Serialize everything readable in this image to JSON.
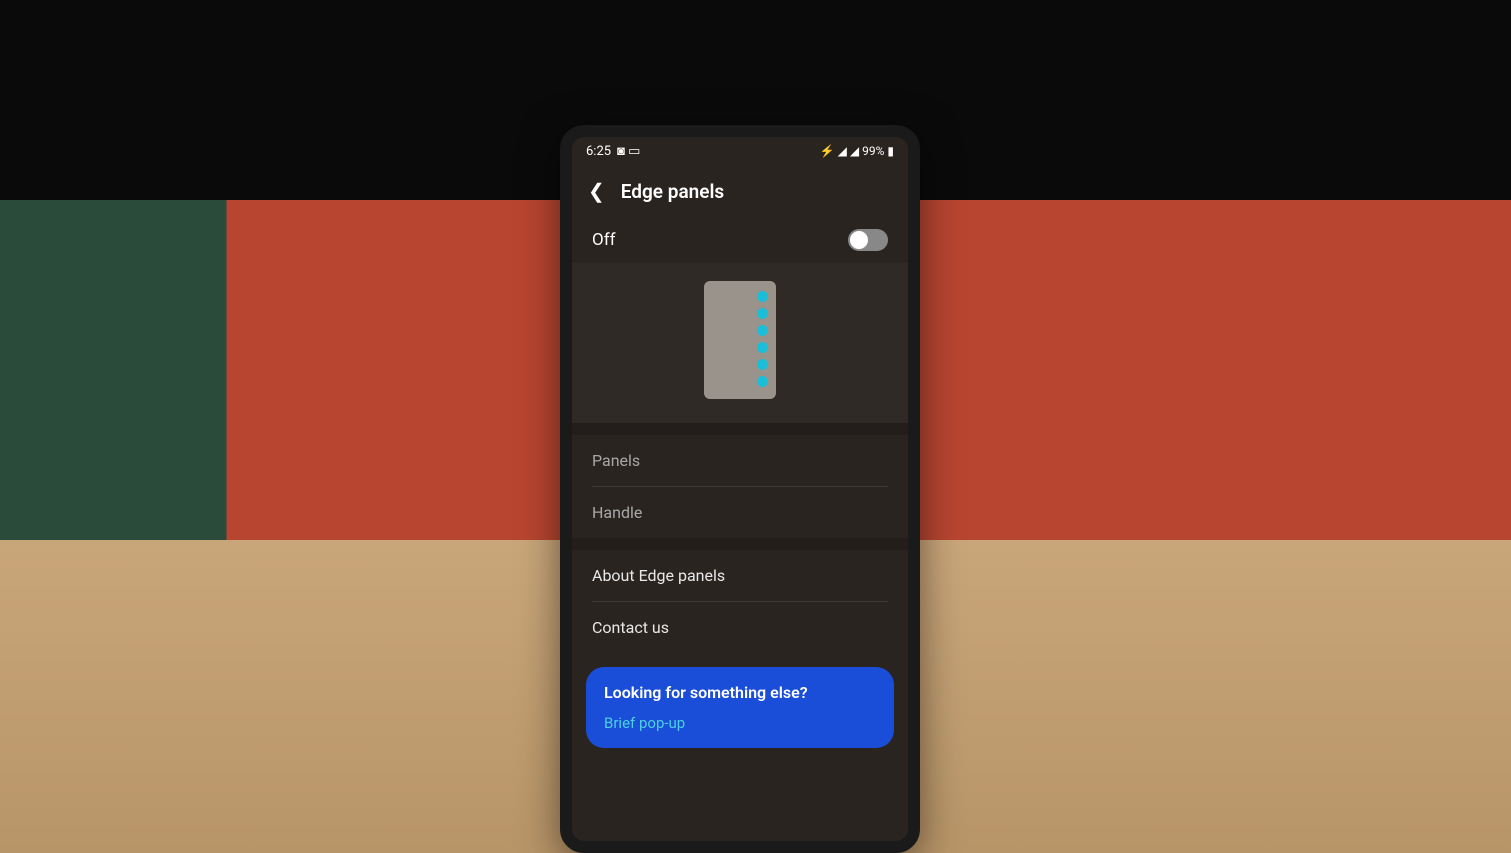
{
  "status_bar": {
    "time": "6:25",
    "battery_pct": "99%"
  },
  "header": {
    "title": "Edge panels"
  },
  "toggle": {
    "label": "Off",
    "state": false
  },
  "menu": {
    "panels": "Panels",
    "handle": "Handle",
    "about": "About Edge panels",
    "contact": "Contact us"
  },
  "suggestion": {
    "title": "Looking for something else?",
    "link": "Brief pop-up"
  }
}
